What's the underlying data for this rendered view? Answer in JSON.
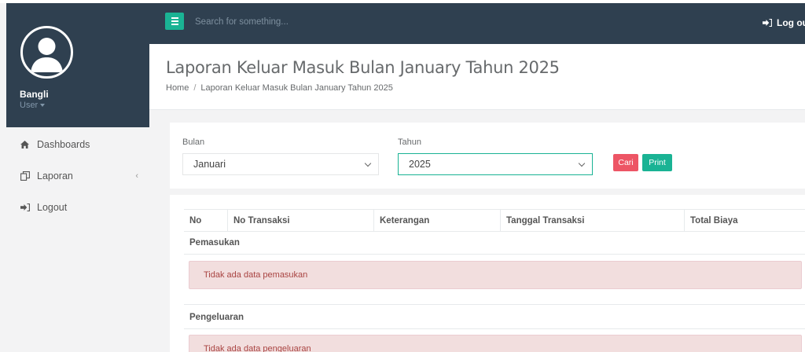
{
  "user": {
    "name": "Bangli",
    "role": "User"
  },
  "sidebar": {
    "items": [
      {
        "label": "Dashboards",
        "icon": "home-icon"
      },
      {
        "label": "Laporan",
        "icon": "copy-icon",
        "chevron": "‹"
      },
      {
        "label": "Logout",
        "icon": "sign-out-icon"
      }
    ]
  },
  "topbar": {
    "search_placeholder": "Search for something...",
    "logout_label": "Log out"
  },
  "heading": {
    "title": "Laporan Keluar Masuk Bulan January Tahun 2025",
    "breadcrumb": [
      "Home",
      "Laporan Keluar Masuk Bulan January Tahun 2025"
    ],
    "breadcrumb_separator": "/"
  },
  "filter": {
    "month_label": "Bulan",
    "month_value": "Januari",
    "year_label": "Tahun",
    "year_value": "2025",
    "search_button": "Cari",
    "print_button": "Print"
  },
  "table": {
    "columns": [
      "No",
      "No Transaksi",
      "Keterangan",
      "Tanggal Transaksi",
      "Total Biaya"
    ],
    "sections": [
      {
        "title": "Pemasukan",
        "empty_message": "Tidak ada data pemasukan"
      },
      {
        "title": "Pengeluaran",
        "empty_message": "Tidak ada data pengeluaran"
      }
    ]
  },
  "colors": {
    "navy": "#2f4050",
    "primary": "#1ab394",
    "danger": "#ed5565",
    "alert_bg": "#f2dede",
    "alert_text": "#a94442"
  }
}
